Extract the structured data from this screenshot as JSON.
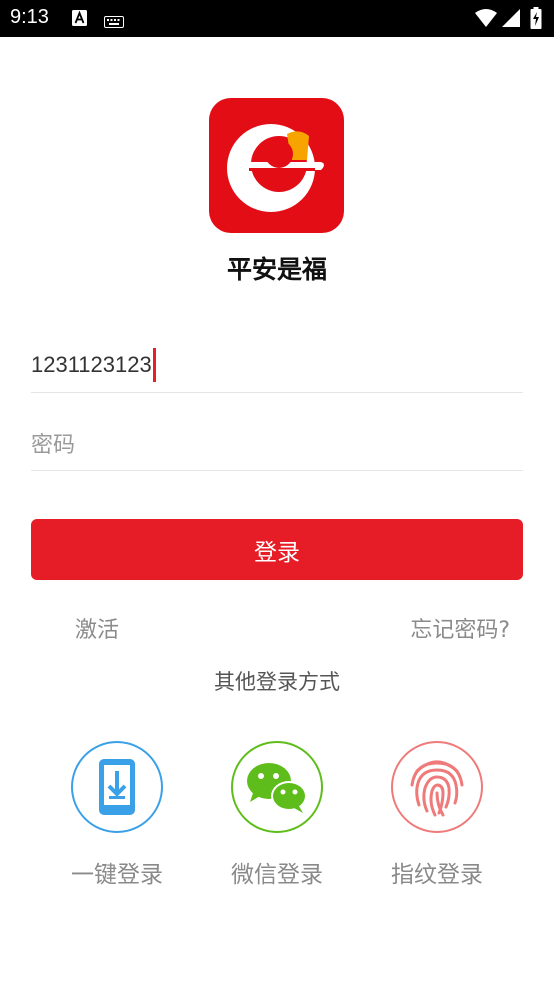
{
  "status_bar": {
    "time": "9:13",
    "icons": [
      "a-badge-icon",
      "keyboard-icon",
      "wifi-icon",
      "cellular-signal-icon",
      "battery-charging-icon"
    ]
  },
  "app": {
    "name": "平安是福",
    "logo_icon": "e-train-logo-icon",
    "brand_color": "#e61d27"
  },
  "login_form": {
    "account_value": "1231123123",
    "password_placeholder": "密码",
    "login_button": "登录"
  },
  "links": {
    "activate": "激活",
    "forgot_password": "忘记密码?"
  },
  "other_login": {
    "title": "其他登录方式",
    "options": [
      {
        "label": "一键登录",
        "icon": "phone-download-icon",
        "color": "#3aa0e8"
      },
      {
        "label": "微信登录",
        "icon": "wechat-icon",
        "color": "#5ebd1a"
      },
      {
        "label": "指纹登录",
        "icon": "fingerprint-icon",
        "color": "#ef7a7a"
      }
    ]
  }
}
